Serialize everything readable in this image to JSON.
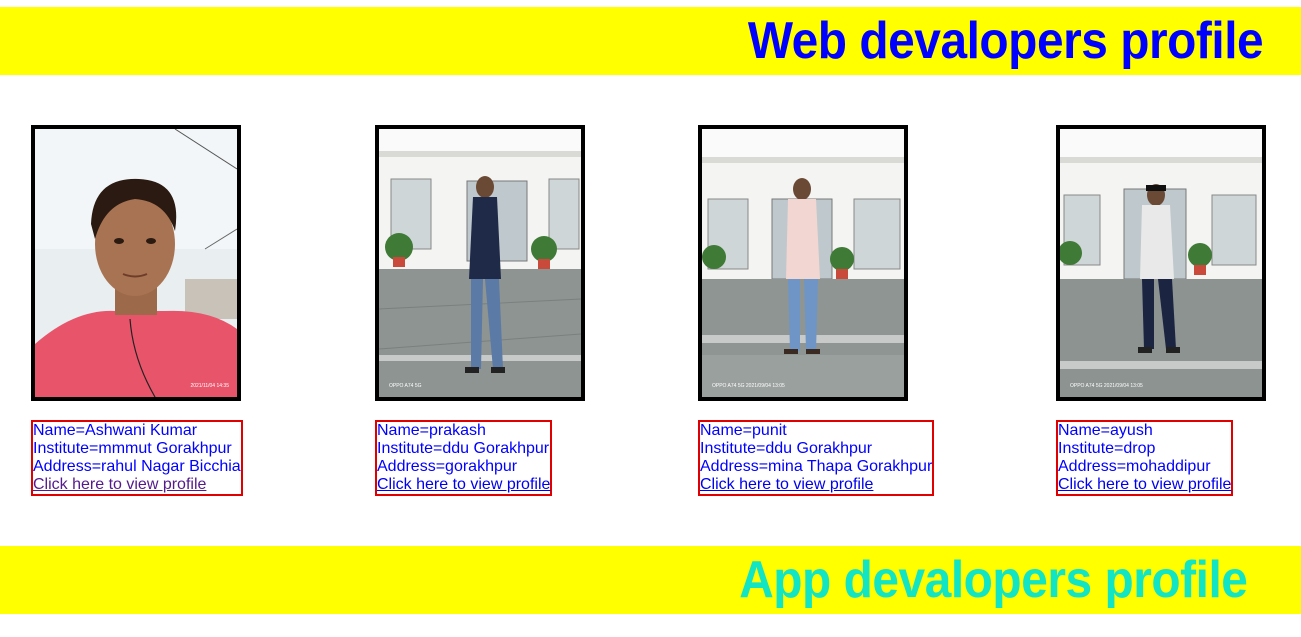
{
  "web_banner": {
    "title": "Web devalopers profile"
  },
  "app_banner": {
    "title": "App devalopers profile"
  },
  "profiles": [
    {
      "name": "Name=Ashwani Kumar",
      "institute": "Institute=mmmut Gorakhpur",
      "address": "Address=rahul Nagar Bicchia",
      "link": "Click here to view profile",
      "photo_stamp": "2021/11/04 14:35"
    },
    {
      "name": "Name=prakash",
      "institute": "Institute=ddu Gorakhpur",
      "address": "Address=gorakhpur",
      "link": "Click here to view profile",
      "photo_stamp": "OPPO A74 5G"
    },
    {
      "name": "Name=punit",
      "institute": "Institute=ddu Gorakhpur",
      "address": "Address=mina Thapa Gorakhpur",
      "link": "Click here to view profile",
      "photo_stamp": "OPPO A74 5G 2021/09/04 13:05"
    },
    {
      "name": "Name=ayush",
      "institute": "Institute=drop",
      "address": "Address=mohaddipur",
      "link": "Click here to view profile",
      "photo_stamp": "OPPO A74 5G 2021/09/04 13:05"
    }
  ],
  "colors": {
    "banner_bg": "#ffff00",
    "web_title": "#0000ff",
    "app_title": "#12e5c4",
    "info_border": "#e00000",
    "info_text": "#0000ff"
  }
}
